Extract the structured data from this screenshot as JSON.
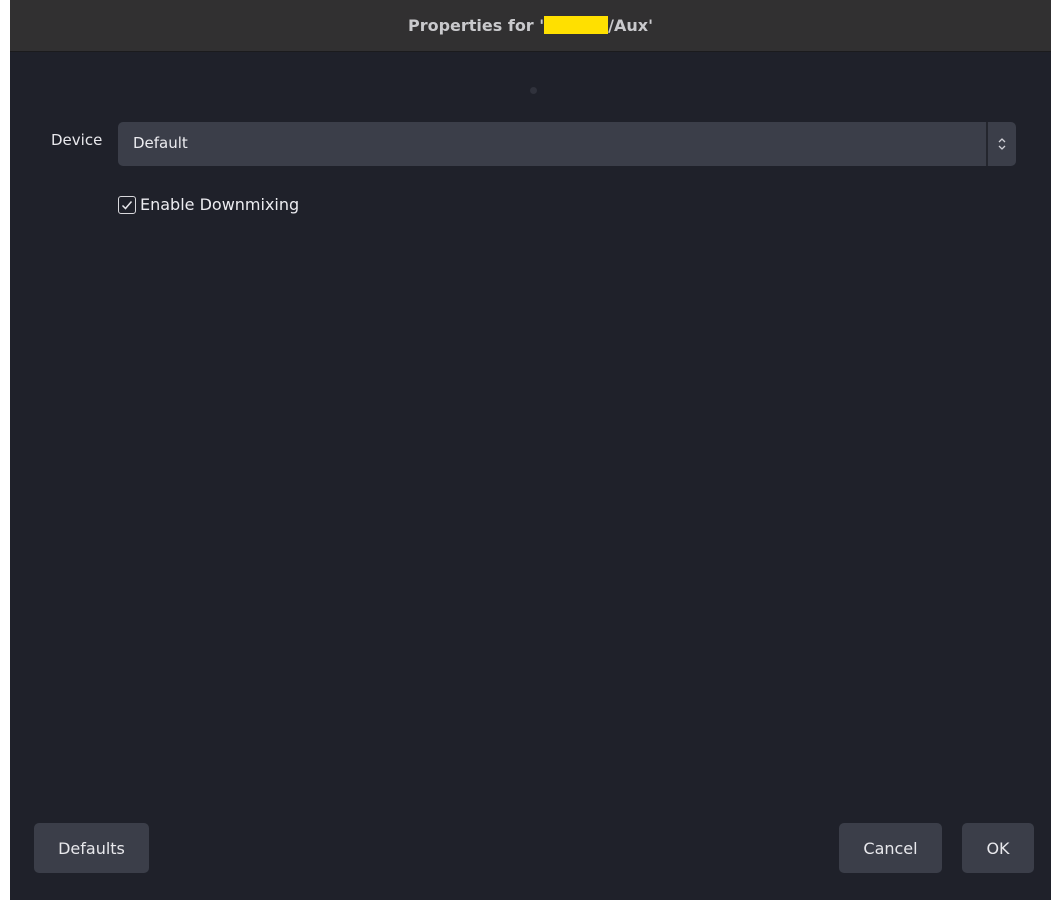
{
  "window": {
    "title_prefix": "Properties for '",
    "title_suffix": "/Aux'"
  },
  "form": {
    "device_label": "Device",
    "device_value": "Default",
    "downmix_label": "Enable Downmixing",
    "downmix_checked": true
  },
  "buttons": {
    "defaults": "Defaults",
    "cancel": "Cancel",
    "ok": "OK"
  },
  "colors": {
    "background": "#1f212a",
    "titlebar": "#313031",
    "control": "#3b3e49",
    "redaction": "#ffe000"
  },
  "icons": {
    "stepper": "chevron-up-down-icon",
    "check": "checkmark-icon"
  }
}
